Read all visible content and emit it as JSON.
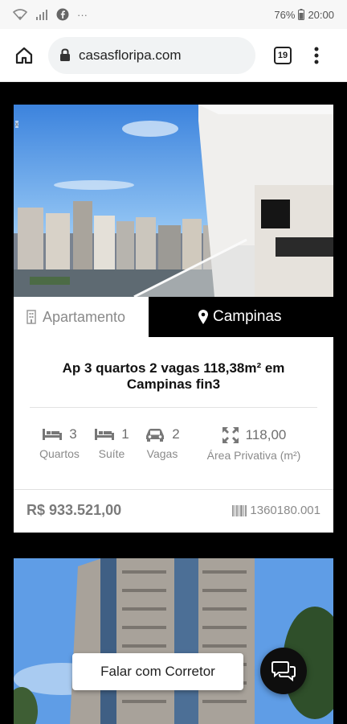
{
  "status_bar": {
    "battery_percent": "76%",
    "time": "20:00",
    "more": "···"
  },
  "browser": {
    "url": "casasfloripa.com",
    "tab_count": "19"
  },
  "listing": {
    "ad_marker": "x",
    "property_type": "Apartamento",
    "location": "Campinas",
    "title": "Ap 3 quartos 2 vagas 118,38m² em Campinas fin3",
    "features": [
      {
        "icon": "bed-icon",
        "value": "3",
        "label": "Quartos"
      },
      {
        "icon": "bed-icon",
        "value": "1",
        "label": "Suíte"
      },
      {
        "icon": "car-icon",
        "value": "2",
        "label": "Vagas"
      },
      {
        "icon": "expand-icon",
        "value": "118,00",
        "label": "Área Privativa (m²)"
      }
    ],
    "price": "R$ 933.521,00",
    "code": "1360180.001"
  },
  "chat": {
    "label": "Falar com Corretor"
  },
  "colors": {
    "page_background": "#000000",
    "card_background": "#ffffff",
    "location_tab": "#000000",
    "muted_text": "#8a8a8a"
  }
}
